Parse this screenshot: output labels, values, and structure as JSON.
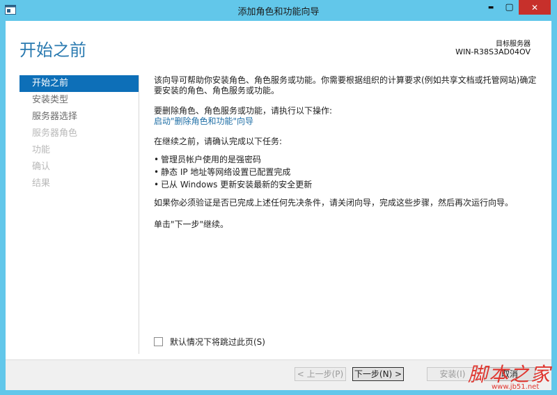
{
  "window": {
    "title": "添加角色和功能向导",
    "min_glyph": "▬",
    "max_glyph": "▢",
    "close_glyph": "✕",
    "titlebar_color": "#62c7ea",
    "close_color": "#c7302b"
  },
  "header": {
    "page_title": "开始之前",
    "dest_label": "目标服务器",
    "dest_server": "WIN-R38S3AD04OV"
  },
  "nav": {
    "items": [
      {
        "label": "开始之前",
        "state": "active"
      },
      {
        "label": "安装类型",
        "state": "enabled"
      },
      {
        "label": "服务器选择",
        "state": "enabled"
      },
      {
        "label": "服务器角色",
        "state": "disabled"
      },
      {
        "label": "功能",
        "state": "disabled"
      },
      {
        "label": "确认",
        "state": "disabled"
      },
      {
        "label": "结果",
        "state": "disabled"
      }
    ],
    "active_color": "#0d6fb8"
  },
  "content": {
    "intro_line1": "该向导可帮助你安装角色、角色服务或功能。你需要根据组织的计算要求(例如共享文档或托管网站)确定",
    "intro_line2": "要安装的角色、角色服务或功能。",
    "remove_prompt": "要删除角色、角色服务或功能，请执行以下操作:",
    "remove_link": "启动\"删除角色和功能\"向导",
    "confirm_prompt": "在继续之前，请确认完成以下任务:",
    "tasks": [
      "管理员帐户使用的是强密码",
      "静态 IP 地址等网络设置已配置完成",
      "已从 Windows 更新安装最新的安全更新"
    ],
    "verify_text": "如果你必须验证是否已完成上述任何先决条件，请关闭向导，完成这些步骤，然后再次运行向导。",
    "next_hint": "单击\"下一步\"继续。"
  },
  "skip": {
    "label": "默认情况下将跳过此页(S)",
    "checked": false
  },
  "footer": {
    "prev_label": "< 上一步(P)",
    "next_label": "下一步(N) >",
    "install_label": "安装(I)",
    "cancel_label": "取消"
  },
  "watermark": {
    "main": "脚本之家",
    "sub": "www.jb51.net",
    "color": "#e0352e"
  }
}
